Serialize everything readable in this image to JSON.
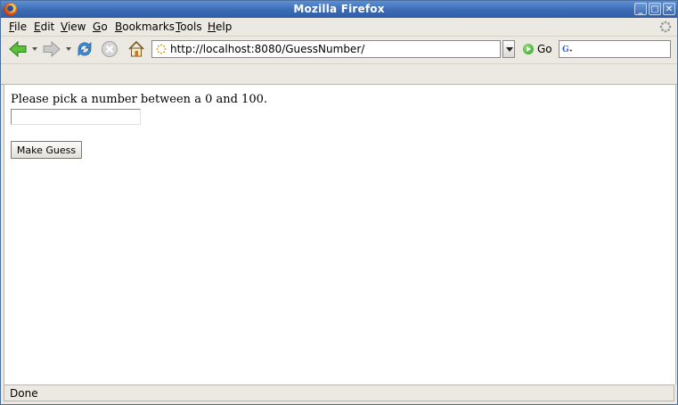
{
  "window": {
    "title": "Mozilla Firefox"
  },
  "menu": {
    "items": [
      {
        "label": "File",
        "accel": "F",
        "rest": "ile"
      },
      {
        "label": "Edit",
        "accel": "E",
        "rest": "dit"
      },
      {
        "label": "View",
        "accel": "V",
        "rest": "iew"
      },
      {
        "label": "Go",
        "accel": "G",
        "rest": "o"
      },
      {
        "label": "Bookmarks",
        "accel": "B",
        "rest": "ookmarks"
      },
      {
        "label": "Tools",
        "accel": "T",
        "rest": "ools"
      },
      {
        "label": "Help",
        "accel": "H",
        "rest": "elp"
      }
    ]
  },
  "navbar": {
    "url": "http://localhost:8080/GuessNumber/",
    "go_label": "Go",
    "search_value": ""
  },
  "page": {
    "prompt": "Please pick a number between a 0 and 100.",
    "guess_value": "",
    "button_label": "Make Guess"
  },
  "status": {
    "text": "Done"
  },
  "colors": {
    "titlebar": "#3a6bb5",
    "chrome": "#ece9e2",
    "content": "#ffffff"
  }
}
